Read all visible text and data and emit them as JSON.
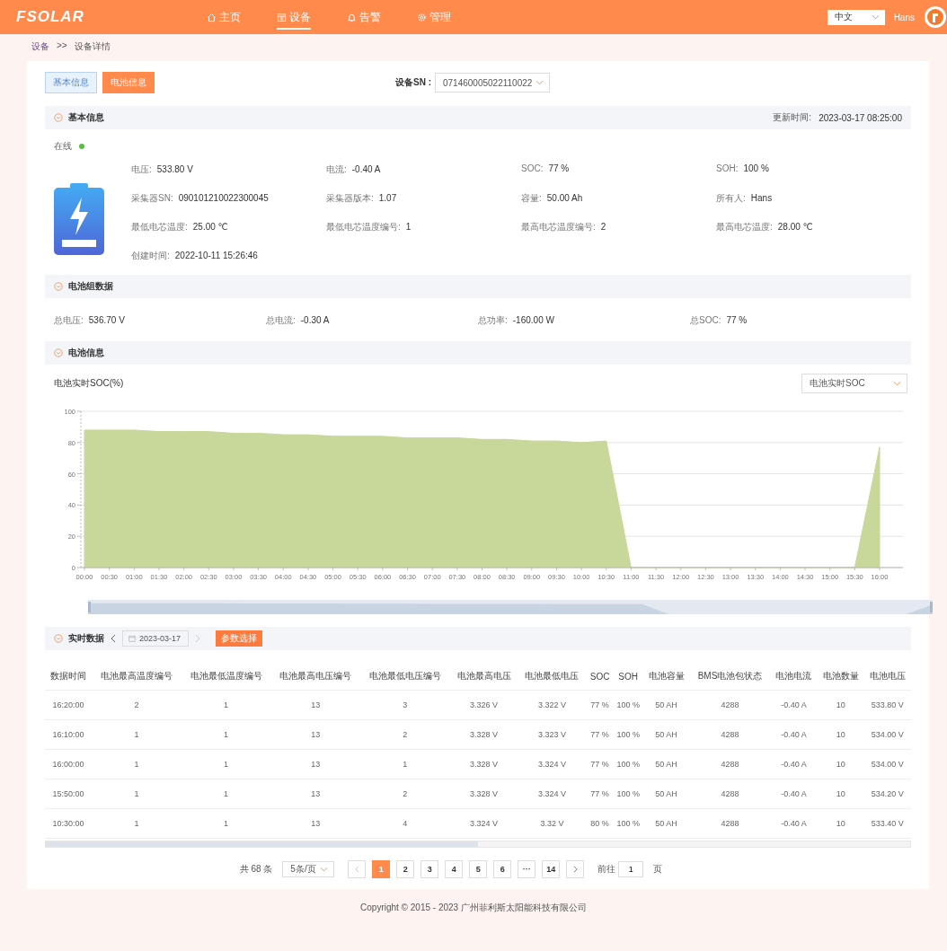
{
  "header": {
    "logo": "FSOLAR",
    "nav": [
      {
        "label": "主页",
        "selected": false
      },
      {
        "label": "设备",
        "selected": true
      },
      {
        "label": "告警",
        "selected": false
      },
      {
        "label": "管理",
        "selected": false
      }
    ],
    "language": "中文",
    "user": "Hans"
  },
  "breadcrumb": {
    "link": "设备",
    "separator": ">>",
    "current": "设备详情"
  },
  "tabs": [
    {
      "label": "基本信息",
      "selected": false
    },
    {
      "label": "电池信息",
      "selected": true
    }
  ],
  "device_sn": {
    "label": "设备SN :",
    "value": "071460005022110022"
  },
  "basic": {
    "title": "基本信息",
    "updated_label": "更新时间:",
    "updated_value": "2023-03-17 08:25:00",
    "status": {
      "label": "在线",
      "online": true
    },
    "fields": [
      {
        "label": "电压:",
        "value": "533.80 V"
      },
      {
        "label": "电流:",
        "value": "-0.40 A"
      },
      {
        "label": "SOC:",
        "value": "77 %"
      },
      {
        "label": "SOH:",
        "value": "100 %"
      },
      {
        "label": "采集器SN:",
        "value": "090101210022300045"
      },
      {
        "label": "采集器版本:",
        "value": "1.07"
      },
      {
        "label": "容量:",
        "value": "50.00 Ah"
      },
      {
        "label": "所有人:",
        "value": "Hans"
      },
      {
        "label": "最低电芯温度:",
        "value": "25.00 ℃"
      },
      {
        "label": "最低电芯温度编号:",
        "value": "1"
      },
      {
        "label": "最高电芯温度编号:",
        "value": "2"
      },
      {
        "label": "最高电芯温度:",
        "value": "28.00 ℃"
      },
      {
        "label": "创建时间:",
        "value": "2022-10-11 15:26:46"
      }
    ]
  },
  "pack": {
    "title": "电池组数据",
    "fields": [
      {
        "label": "总电压:",
        "value": "536.70 V"
      },
      {
        "label": "总电流:",
        "value": "-0.30 A"
      },
      {
        "label": "总功率:",
        "value": "-160.00 W"
      },
      {
        "label": "总SOC:",
        "value": "77 %"
      }
    ]
  },
  "battery": {
    "title": "电池信息",
    "chart_title": "电池实时SOC(%)",
    "select": "电池实时SOC",
    "chart_data": {
      "type": "area",
      "categories": [
        "00:00",
        "00:30",
        "01:00",
        "01:30",
        "02:00",
        "02:30",
        "03:00",
        "03:30",
        "04:00",
        "04:30",
        "05:00",
        "05:30",
        "06:00",
        "06:30",
        "07:00",
        "07:30",
        "08:00",
        "08:30",
        "09:00",
        "09:30",
        "10:00",
        "10:30",
        "11:00",
        "11:30",
        "12:00",
        "12:30",
        "13:00",
        "13:30",
        "14:00",
        "14:30",
        "15:00",
        "15:30",
        "16:00"
      ],
      "series": [
        {
          "color": "#c8d89a",
          "values": [
            88,
            88,
            88,
            87,
            87,
            87,
            86,
            86,
            85,
            85,
            84,
            84,
            84,
            83,
            83,
            83,
            82,
            82,
            81,
            81,
            80,
            81,
            0,
            0,
            0,
            0,
            0,
            0,
            0,
            0,
            0,
            0,
            77
          ]
        }
      ],
      "ylim": [
        0,
        100
      ],
      "yticks": [
        0,
        20,
        40,
        60,
        80,
        100
      ],
      "grid": true
    },
    "range_slider": {
      "level": 1
    }
  },
  "realtime": {
    "title": "实时数据",
    "date": "2023-03-17",
    "param_button": "参数选择",
    "columns": [
      "数据时间",
      "电池最高温度编号",
      "电池最低温度编号",
      "电池最高电压编号",
      "电池最低电压编号",
      "电池最高电压",
      "电池最低电压",
      "SOC",
      "SOH",
      "电池容量",
      "BMS电池包状态",
      "电池电流",
      "电池数量",
      "电池电压"
    ],
    "rows": [
      [
        "16:20:00",
        "2",
        "1",
        "13",
        "3",
        "3.326 V",
        "3.322 V",
        "77 %",
        "100 %",
        "50 AH",
        "4288",
        "-0.40 A",
        "10",
        "533.80 V"
      ],
      [
        "16:10:00",
        "1",
        "1",
        "13",
        "2",
        "3.328 V",
        "3.323 V",
        "77 %",
        "100 %",
        "50 AH",
        "4288",
        "-0.40 A",
        "10",
        "534.00 V"
      ],
      [
        "16:00:00",
        "1",
        "1",
        "13",
        "1",
        "3.328 V",
        "3.324 V",
        "77 %",
        "100 %",
        "50 AH",
        "4288",
        "-0.40 A",
        "10",
        "534.00 V"
      ],
      [
        "15:50:00",
        "1",
        "1",
        "13",
        "2",
        "3.328 V",
        "3.324 V",
        "77 %",
        "100 %",
        "50 AH",
        "4288",
        "-0.40 A",
        "10",
        "534.20 V"
      ],
      [
        "10:30:00",
        "1",
        "1",
        "13",
        "4",
        "3.324 V",
        "3.32 V",
        "80 %",
        "100 %",
        "50 AH",
        "4288",
        "-0.40 A",
        "10",
        "533.40 V"
      ]
    ]
  },
  "pagination": {
    "total": "共 68 条",
    "page_size": "5条/页",
    "pages": [
      {
        "label": "1",
        "selected": true
      },
      {
        "label": "2",
        "selected": false
      },
      {
        "label": "3",
        "selected": false
      },
      {
        "label": "4",
        "selected": false
      },
      {
        "label": "5",
        "selected": false
      },
      {
        "label": "6",
        "selected": false
      },
      {
        "label": "···",
        "selected": false
      },
      {
        "label": "14",
        "selected": false
      }
    ],
    "goto_label": "前往",
    "goto_value": "1",
    "page_unit": "页"
  },
  "footer": "Copyright © 2015 - 2023 广州菲利斯太阳能科技有限公司"
}
